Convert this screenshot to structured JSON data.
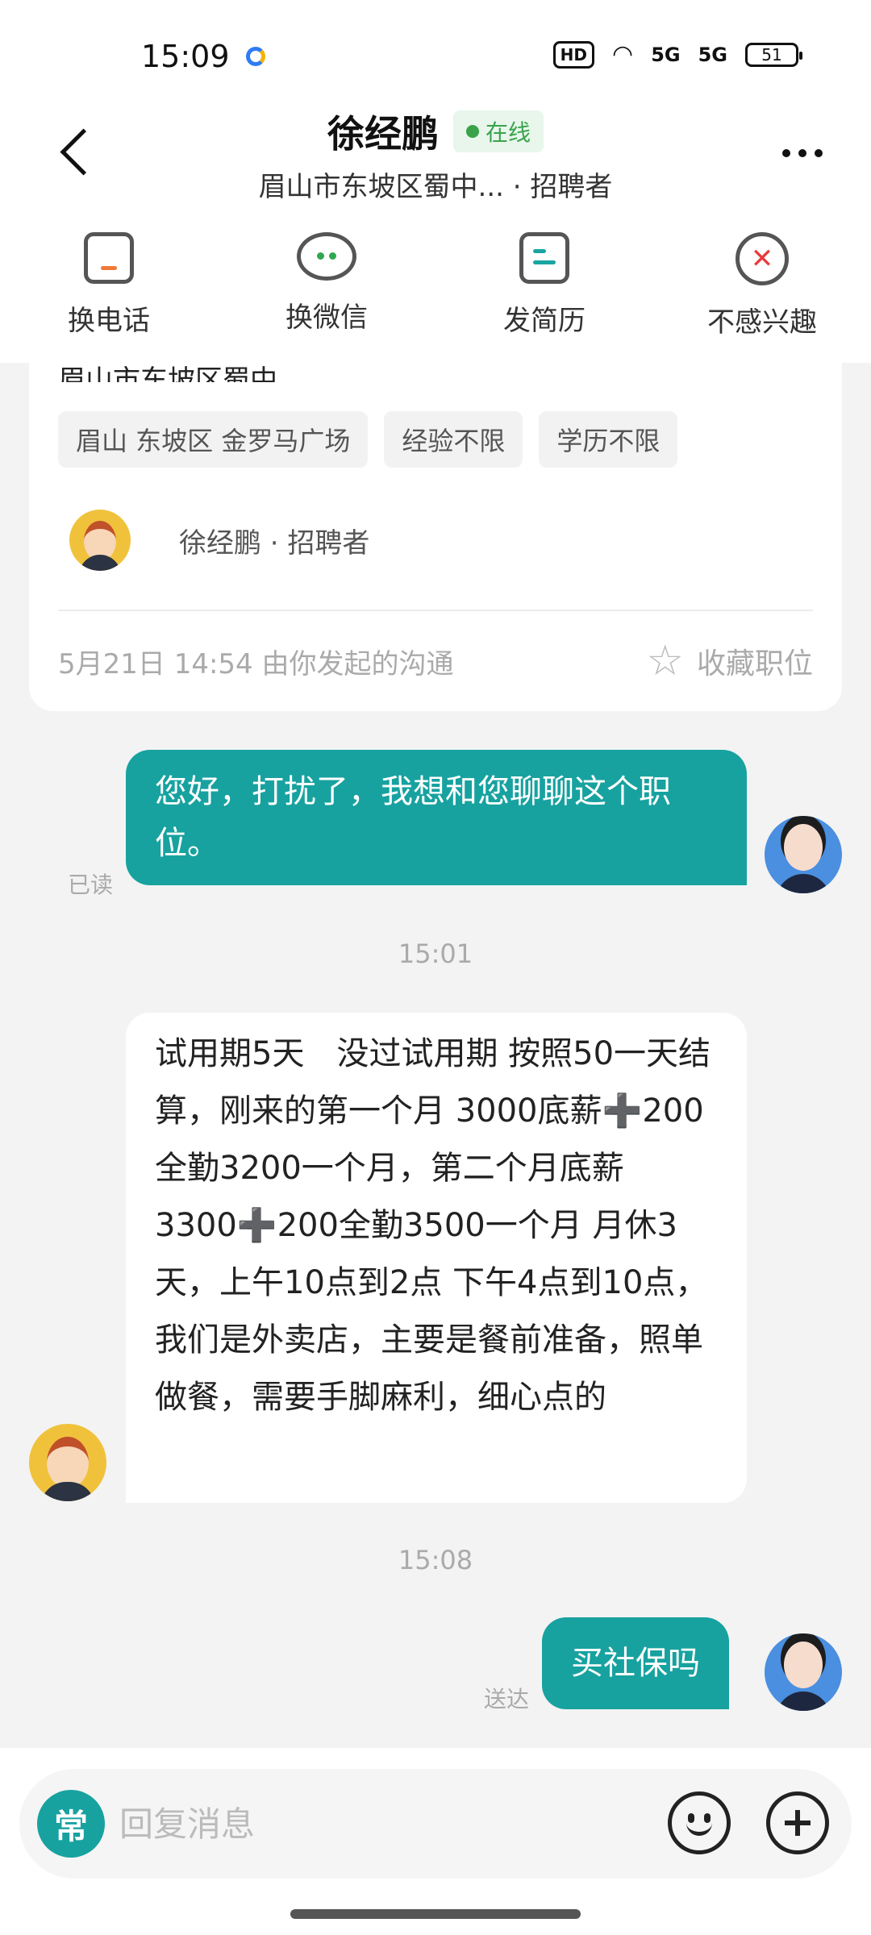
{
  "status": {
    "time": "15:09",
    "hd": "HD",
    "net1": "5G",
    "net2": "5G",
    "battery": "51"
  },
  "header": {
    "name": "徐经鹏",
    "online": "在线",
    "subtitle": "眉山市东坡区蜀中... · 招聘者"
  },
  "actions": {
    "phone": "换电话",
    "wechat": "换微信",
    "resume": "发简历",
    "not_interested": "不感兴趣"
  },
  "card": {
    "address": "眉山市东坡区蜀中...",
    "tags": [
      "眉山 东坡区 金罗马广场",
      "经验不限",
      "学历不限"
    ],
    "recruiter": "徐经鹏 · 招聘者",
    "started": "5月21日 14:54 由你发起的沟通",
    "favorite": "收藏职位"
  },
  "messages": {
    "m1": {
      "text": "您好，打扰了，我想和您聊聊这个职位。",
      "status": "已读"
    },
    "t1": "15:01",
    "m2": {
      "text": "试用期5天　没过试用期 按照50一天结算，刚来的第一个月 3000底薪➕200全勤3200一个月，第二个月底薪3300➕200全勤3500一个月 月休3天，上午10点到2点 下午4点到10点，我们是外卖店，主要是餐前准备，照单做餐，需要手脚麻利，细心点的"
    },
    "t2": "15:08",
    "m3": {
      "text": "买社保吗",
      "status": "送达"
    }
  },
  "input": {
    "quick": "常",
    "placeholder": "回复消息"
  }
}
